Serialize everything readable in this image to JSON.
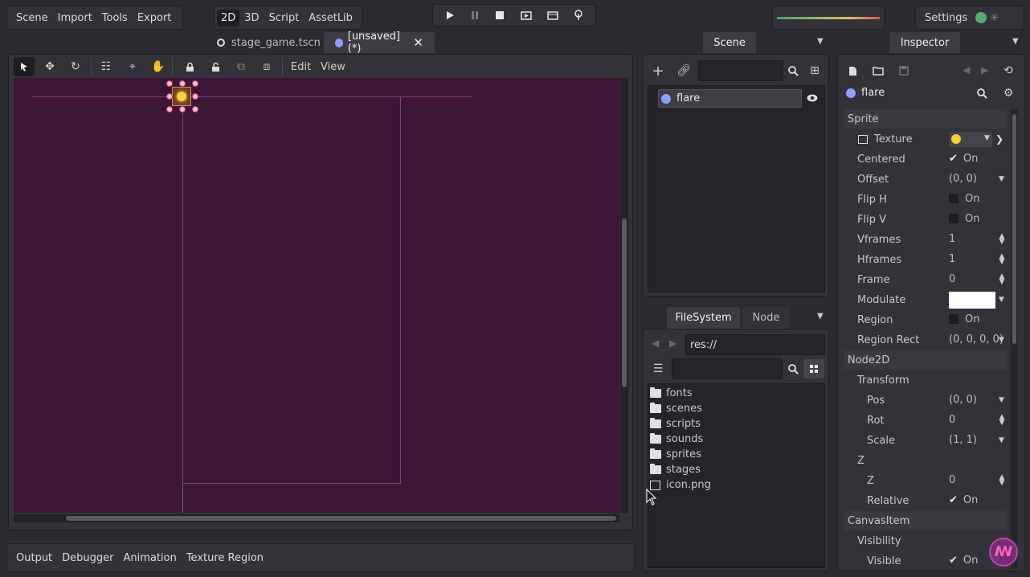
{
  "menus": {
    "scene": "Scene",
    "import": "Import",
    "tools": "Tools",
    "export": "Export"
  },
  "modes": {
    "d2": "2D",
    "d3": "3D",
    "script": "Script",
    "assetlib": "AssetLib"
  },
  "settings_label": "Settings",
  "tabs": {
    "stage": "stage_game.tscn",
    "unsaved": "[unsaved](*)"
  },
  "viewport_menu": {
    "edit": "Edit",
    "view": "View"
  },
  "scene_dock": {
    "tab": "Scene",
    "node": "flare"
  },
  "filesystem": {
    "tab": "FileSystem",
    "node_tab": "Node",
    "path": "res://",
    "items": [
      "fonts",
      "scenes",
      "scripts",
      "sounds",
      "sprites",
      "stages",
      "icon.png"
    ]
  },
  "inspector": {
    "tab": "Inspector",
    "object": "flare",
    "sprite": "Sprite",
    "texture": "Texture",
    "centered": "Centered",
    "centered_val": "On",
    "offset": "Offset",
    "offset_val": "(0, 0)",
    "fliph": "Flip H",
    "fliph_val": "On",
    "flipv": "Flip V",
    "flipv_val": "On",
    "vframes": "Vframes",
    "vframes_val": "1",
    "hframes": "Hframes",
    "hframes_val": "1",
    "frame": "Frame",
    "frame_val": "0",
    "modulate": "Modulate",
    "region": "Region",
    "region_val": "On",
    "region_rect": "Region Rect",
    "region_rect_val": "(0, 0, 0, 0)",
    "node2d": "Node2D",
    "transform": "Transform",
    "pos": "Pos",
    "pos_val": "(0, 0)",
    "rot": "Rot",
    "rot_val": "0",
    "scale": "Scale",
    "scale_val": "(1, 1)",
    "z_section": "Z",
    "z": "Z",
    "z_val": "0",
    "relative": "Relative",
    "relative_val": "On",
    "canvasitem": "CanvasItem",
    "visibility": "Visibility",
    "visible": "Visible",
    "visible_val": "On"
  },
  "bottom": {
    "output": "Output",
    "debugger": "Debugger",
    "animation": "Animation",
    "texture_region": "Texture Region"
  },
  "colors": {
    "viewport": "#3d1537",
    "accent": "#6f8fff"
  }
}
